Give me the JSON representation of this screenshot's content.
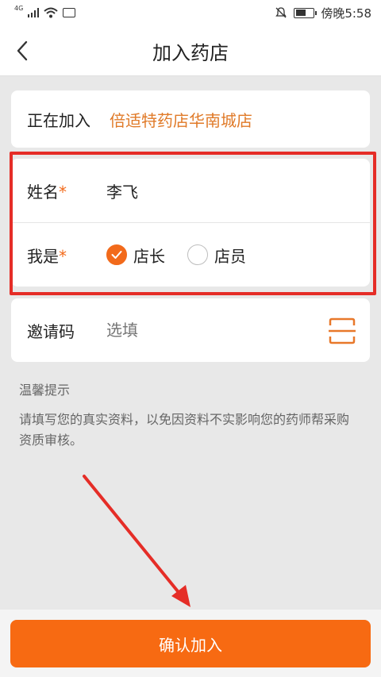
{
  "status_bar": {
    "network": "4G",
    "time": "傍晚5:58"
  },
  "nav": {
    "title": "加入药店"
  },
  "join_card": {
    "label": "正在加入",
    "store_name": "倍适特药店华南城店"
  },
  "form": {
    "name_label": "姓名",
    "name_required_mark": "*",
    "name_value": "李飞",
    "role_label": "我是",
    "role_required_mark": "*",
    "role_options": [
      {
        "label": "店长",
        "checked": true
      },
      {
        "label": "店员",
        "checked": false
      }
    ]
  },
  "invite": {
    "label": "邀请码",
    "placeholder": "选填"
  },
  "tips": {
    "title": "温馨提示",
    "text": "请填写您的真实资料，以免因资料不实影响您的药师帮采购资质审核。"
  },
  "confirm_button": {
    "label": "确认加入"
  },
  "colors": {
    "accent": "#f76a12",
    "store_name": "#e07a28",
    "highlight": "#e52d27"
  }
}
